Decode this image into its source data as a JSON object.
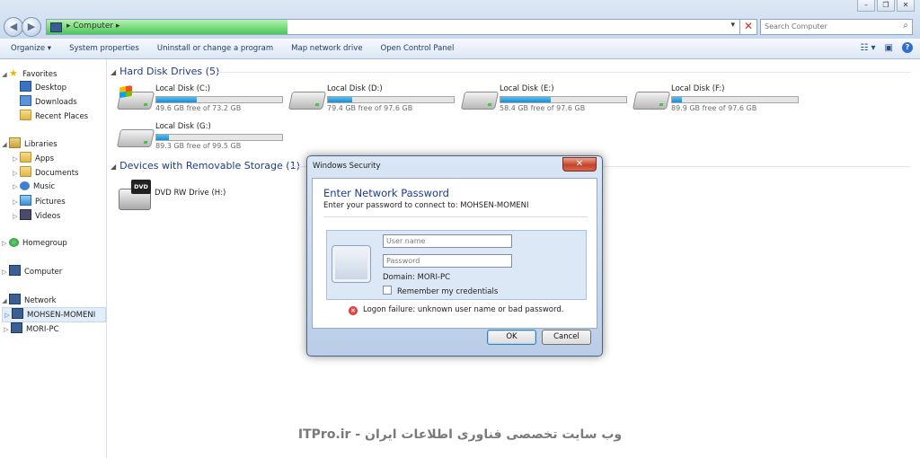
{
  "address_bar": {
    "breadcrumb": "Computer",
    "search_placeholder": "Search Computer"
  },
  "toolbar": {
    "organize": "Organize ▾",
    "system_properties": "System properties",
    "uninstall": "Uninstall or change a program",
    "map_drive": "Map network drive",
    "control_panel": "Open Control Panel"
  },
  "nav": {
    "favorites": "Favorites",
    "desktop": "Desktop",
    "downloads": "Downloads",
    "recent": "Recent Places",
    "libraries": "Libraries",
    "apps": "Apps",
    "documents": "Documents",
    "music": "Music",
    "pictures": "Pictures",
    "videos": "Videos",
    "homegroup": "Homegroup",
    "computer": "Computer",
    "network": "Network",
    "net_pc1": "MOHSEN-MOMENI",
    "net_pc2": "MORI-PC"
  },
  "hard_disks": {
    "title": "Hard Disk Drives (5)",
    "drives": [
      {
        "name": "Local Disk (C:)",
        "free": "49.6 GB free of 73.2 GB",
        "used_fraction": 0.32
      },
      {
        "name": "Local Disk (D:)",
        "free": "79.4 GB free of 97.6 GB",
        "used_fraction": 0.19
      },
      {
        "name": "Local Disk (E:)",
        "free": "58.4 GB free of 97.6 GB",
        "used_fraction": 0.4
      },
      {
        "name": "Local Disk (F:)",
        "free": "89.9 GB free of 97.6 GB",
        "used_fraction": 0.08
      },
      {
        "name": "Local Disk (G:)",
        "free": "89.3 GB free of 99.5 GB",
        "used_fraction": 0.1
      }
    ]
  },
  "removable": {
    "title": "Devices with Removable Storage (1)",
    "dvd": "DVD RW Drive (H:)",
    "dvd_badge": "DVD"
  },
  "dialog": {
    "title": "Windows Security",
    "heading": "Enter Network Password",
    "subtitle": "Enter your password to connect to: MOHSEN-MOMENI",
    "username_placeholder": "User name",
    "password_placeholder": "Password",
    "domain": "Domain: MORI-PC",
    "remember": "Remember my credentials",
    "error": "Logon failure: unknown user name or bad password.",
    "ok": "OK",
    "cancel": "Cancel"
  },
  "footer": {
    "text": "ITPro.ir - وب سایت تخصصی فناوری اطلاعات ایران"
  },
  "colors": {
    "accent": "#1c3c8c",
    "group_title": "#1e3a8a",
    "drive_bar": "#1e8ad1",
    "error": "#c21616"
  }
}
